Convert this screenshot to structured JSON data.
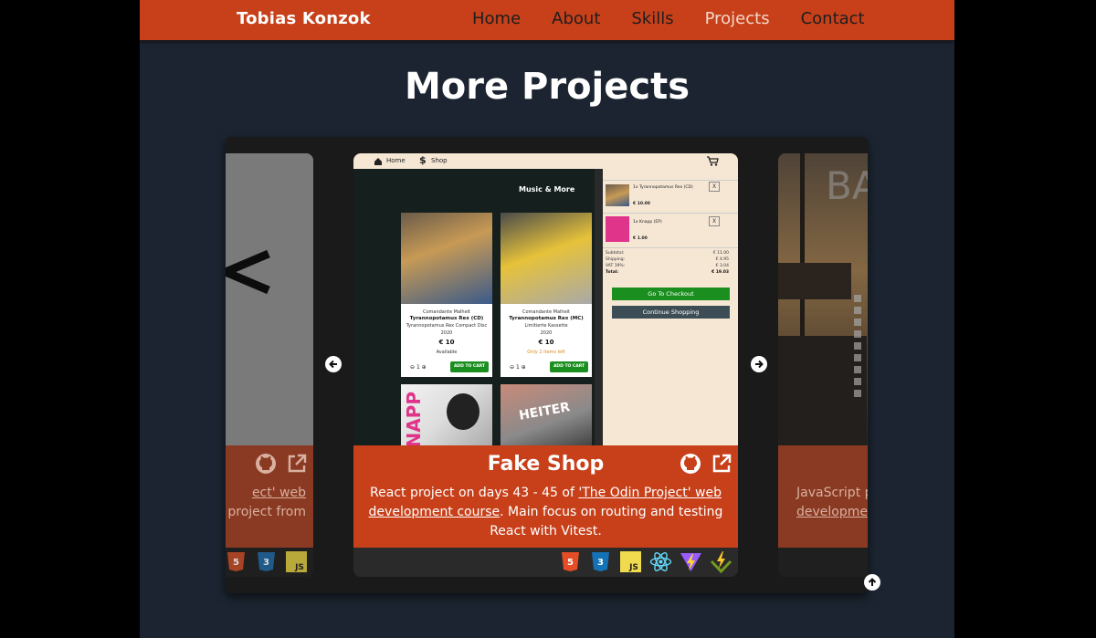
{
  "nav": {
    "brand": "Tobias Konzok",
    "links": [
      "Home",
      "About",
      "Skills",
      "Projects",
      "Contact"
    ],
    "active_index": 3
  },
  "heading": "More Projects",
  "carousel": {
    "left_card": {
      "desc_line1": "ect' web",
      "desc_line2": "project from",
      "tech": [
        "html5-icon",
        "css3-icon",
        "javascript-icon"
      ]
    },
    "center_card": {
      "title": "Fake Shop",
      "desc_pre": "React project on days 43 - 45 of ",
      "desc_link": "'The Odin Project' web development course",
      "desc_post": ". Main focus on routing and testing React with Vitest.",
      "tech": [
        "html5-icon",
        "css3-icon",
        "javascript-icon",
        "react-icon",
        "vite-icon",
        "vitest-icon"
      ],
      "screenshot": {
        "nav_home": "Home",
        "nav_shop": "Shop",
        "section_title": "Music & More",
        "products": [
          {
            "artist": "Comandante Malheit",
            "name": "Tyrannopotamus Rex (CD)",
            "format": "Tyrannopotamus Rex Compact Disc",
            "year": "2020",
            "price": "€ 10",
            "status": "Available",
            "qty": "1"
          },
          {
            "artist": "Comandante Malheit",
            "name": "Tyrannopotamus Rex (MC)",
            "format": "Limitierte Kassette",
            "year": "2020",
            "price": "€ 10",
            "status": "Only 2 items left",
            "qty": "1"
          }
        ],
        "add_to_cart": "ADD TO CART",
        "cart_items": [
          {
            "label": "1x Tyrannopotamus Rex (CD)",
            "price": "€ 10.00"
          },
          {
            "label": "1x Knapp (EP)",
            "price": "€ 1.00"
          }
        ],
        "summary": [
          {
            "label": "Subtotal:",
            "value": "€ 11.00"
          },
          {
            "label": "Shipping:",
            "value": "€ 4.95"
          },
          {
            "label": "VAT 19%:",
            "value": "€ 3.04"
          },
          {
            "label": "Total:",
            "value": "€ 19.03"
          }
        ],
        "checkout": "Go To Checkout",
        "continue": "Continue Shopping",
        "album1_text": "KNAPP",
        "album2_text": "HEITER"
      }
    },
    "right_card": {
      "desc_line1": "JavaScript p",
      "desc_line2": "development",
      "screen_text": "BA"
    }
  },
  "colors": {
    "accent": "#c7401a",
    "page_bg": "#1b2430",
    "carousel_bg": "#1a1a1a"
  }
}
